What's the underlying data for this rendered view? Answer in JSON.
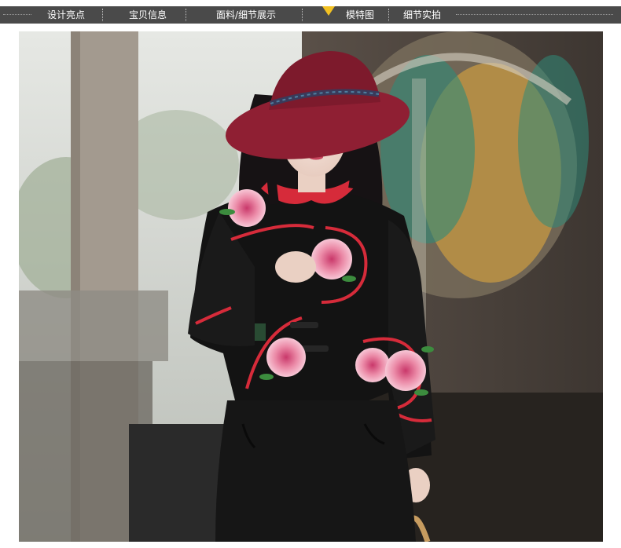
{
  "nav": {
    "tabs": [
      {
        "label": "设计亮点",
        "active": false
      },
      {
        "label": "宝贝信息",
        "active": false
      },
      {
        "label": "面料/细节展示",
        "active": false
      },
      {
        "label": "模特图",
        "active": true
      },
      {
        "label": "细节实拍",
        "active": false
      }
    ],
    "background_color": "#4a4a4a",
    "marker_color": "#f3c223"
  },
  "photo": {
    "icon": "model-photo-image",
    "colors": {
      "hat": "#8f1f33",
      "jacket": "#141414",
      "collar": "#d62b3a",
      "flower": "#e9829c"
    }
  }
}
